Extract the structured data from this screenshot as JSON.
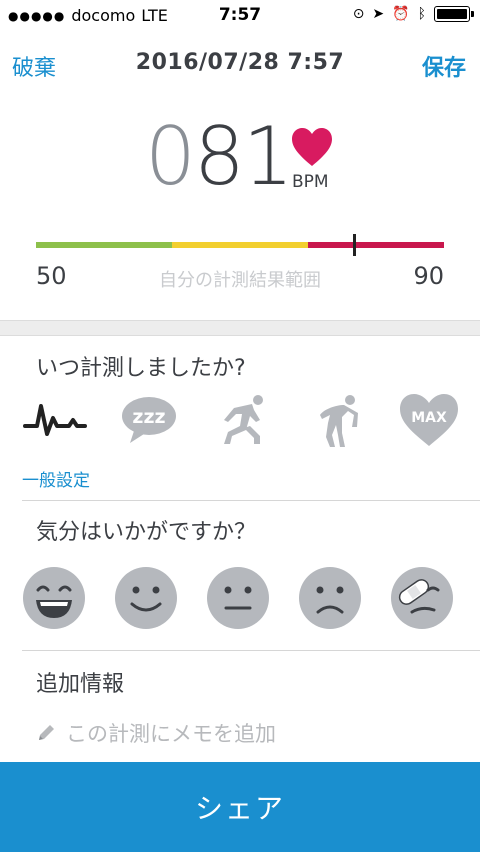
{
  "status_bar": {
    "carrier": "docomo",
    "network": "LTE",
    "time": "7:57"
  },
  "nav": {
    "discard_label": "破棄",
    "title": "2016/07/28 7:57",
    "save_label": "保存"
  },
  "reading": {
    "value_lead": "0",
    "value_main": "81",
    "unit": "BPM",
    "heart_color": "#d81b60"
  },
  "range": {
    "min": "50",
    "max": "90",
    "label": "自分の計測結果範囲",
    "current_fraction": 0.78,
    "segments": [
      {
        "color": "#8dc04b",
        "fraction": 0.333
      },
      {
        "color": "#f2cf2f",
        "fraction": 0.333
      },
      {
        "color": "#c8174d",
        "fraction": 0.334
      }
    ]
  },
  "when_question": "いつ計測しましたか?",
  "activities": [
    {
      "name": "general-icon",
      "selected": true
    },
    {
      "name": "sleep-icon",
      "selected": false
    },
    {
      "name": "before-exercise-icon",
      "selected": false
    },
    {
      "name": "after-exercise-icon",
      "selected": false
    },
    {
      "name": "max-icon",
      "selected": false
    }
  ],
  "activity_selected_label": "一般設定",
  "mood_question": "気分はいかがですか？",
  "moods": [
    "very-happy-icon",
    "happy-icon",
    "neutral-icon",
    "sad-icon",
    "injured-icon"
  ],
  "extra": {
    "title": "追加情報",
    "memo_placeholder": "この計測にメモを追加"
  },
  "share_label": "シェア",
  "colors": {
    "accent": "#1a8fcf",
    "icon_gray": "#b5b8bd",
    "text_dark": "#3c3f44"
  }
}
